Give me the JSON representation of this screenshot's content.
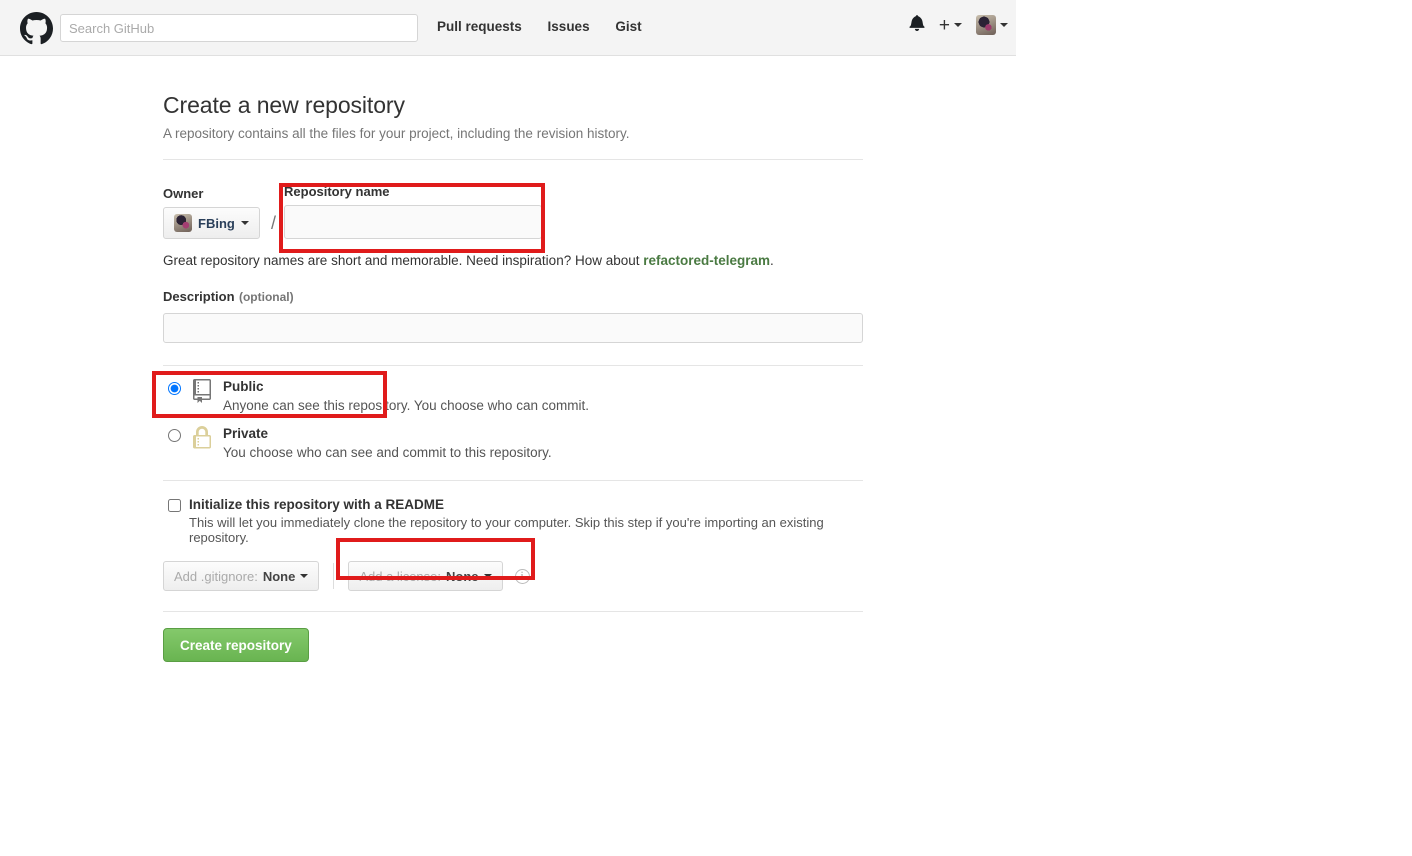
{
  "header": {
    "logo_name": "github-octocat-logo",
    "search": {
      "placeholder": "Search GitHub",
      "value": ""
    },
    "nav": [
      {
        "label": "Pull requests"
      },
      {
        "label": "Issues"
      },
      {
        "label": "Gist"
      }
    ],
    "notifications_icon": "bell-icon",
    "create_new_label": "+",
    "avatar_label": "FBing"
  },
  "page": {
    "title": "Create a new repository",
    "subtitle": "A repository contains all the files for your project, including the revision history."
  },
  "form": {
    "owner_label": "Owner",
    "owner_value": "FBing",
    "separator": "/",
    "repo_name_label": "Repository name",
    "repo_name_value": "",
    "hint_prefix": "Great repository names are short and memorable. Need inspiration? How about ",
    "hint_suggestion": "refactored-telegram",
    "hint_suffix": ".",
    "description_label": "Description",
    "description_optional": "(optional)",
    "description_value": "",
    "visibility": [
      {
        "id": "public",
        "title": "Public",
        "description": "Anyone can see this repository. You choose who can commit.",
        "icon": "repo-book-icon",
        "selected": true
      },
      {
        "id": "private",
        "title": "Private",
        "description": "You choose who can see and commit to this repository.",
        "icon": "lock-icon",
        "selected": false
      }
    ],
    "readme_title": "Initialize this repository with a README",
    "readme_description": "This will let you immediately clone the repository to your computer. Skip this step if you're importing an existing repository.",
    "readme_checked": false,
    "gitignore_prefix": "Add .gitignore: ",
    "gitignore_value": "None",
    "license_prefix": "Add a license: ",
    "license_value": "None",
    "license_info_icon": "info-icon",
    "submit_label": "Create repository"
  },
  "annotations": {
    "color": "#e01b1b",
    "boxes": [
      {
        "name": "repository-name-highlight"
      },
      {
        "name": "public-option-highlight"
      },
      {
        "name": "add-license-highlight"
      }
    ]
  }
}
